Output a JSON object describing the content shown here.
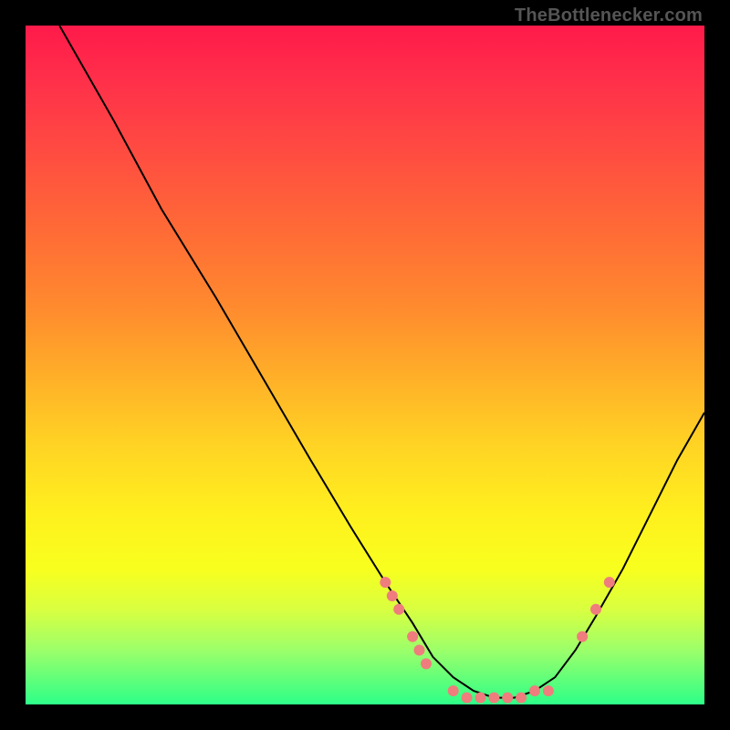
{
  "watermark": "TheBottlenecker.com",
  "chart_data": {
    "type": "line",
    "title": "",
    "xlabel": "",
    "ylabel": "",
    "xlim": [
      0,
      100
    ],
    "ylim": [
      0,
      100
    ],
    "grid": false,
    "background": "heatmap-gradient-vertical",
    "gradient_stops": [
      {
        "pos": 0.0,
        "color": "#ff1a4a"
      },
      {
        "pos": 0.5,
        "color": "#ffb028"
      },
      {
        "pos": 0.8,
        "color": "#f8ff1e"
      },
      {
        "pos": 1.0,
        "color": "#2dff88"
      }
    ],
    "series": [
      {
        "name": "bottleneck-curve",
        "x": [
          5,
          13,
          20,
          28,
          35,
          42,
          48,
          53,
          57,
          60,
          63,
          66,
          69,
          72,
          75,
          78,
          81,
          84,
          88,
          92,
          96,
          100
        ],
        "y": [
          100,
          86,
          73,
          60,
          48,
          36,
          26,
          18,
          12,
          7,
          4,
          2,
          1,
          1,
          2,
          4,
          8,
          13,
          20,
          28,
          36,
          43
        ],
        "stroke": "#000000",
        "stroke_width": 2
      }
    ],
    "markers": [
      {
        "x": 53,
        "y": 18
      },
      {
        "x": 54,
        "y": 16
      },
      {
        "x": 55,
        "y": 14
      },
      {
        "x": 57,
        "y": 10
      },
      {
        "x": 58,
        "y": 8
      },
      {
        "x": 59,
        "y": 6
      },
      {
        "x": 63,
        "y": 2
      },
      {
        "x": 65,
        "y": 1
      },
      {
        "x": 67,
        "y": 1
      },
      {
        "x": 69,
        "y": 1
      },
      {
        "x": 71,
        "y": 1
      },
      {
        "x": 73,
        "y": 1
      },
      {
        "x": 75,
        "y": 2
      },
      {
        "x": 77,
        "y": 2
      },
      {
        "x": 82,
        "y": 10
      },
      {
        "x": 84,
        "y": 14
      },
      {
        "x": 86,
        "y": 18
      }
    ],
    "marker_style": {
      "color": "#ef7d7d",
      "radius": 6
    }
  }
}
